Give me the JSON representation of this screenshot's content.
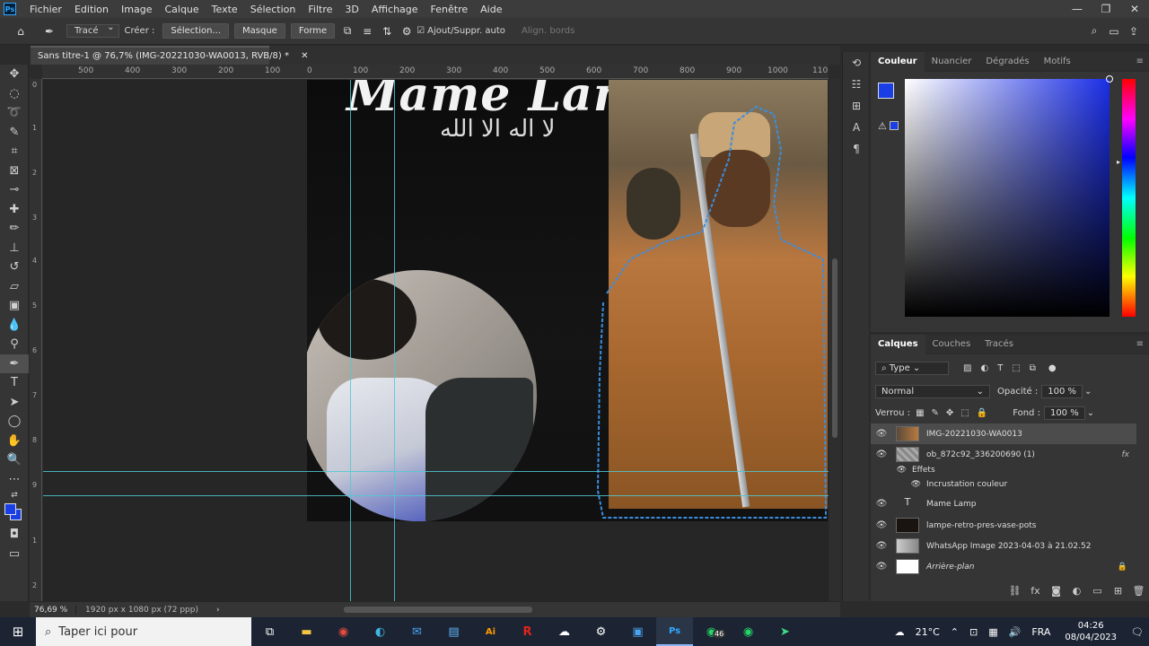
{
  "menubar": {
    "items": [
      "Fichier",
      "Edition",
      "Image",
      "Calque",
      "Texte",
      "Sélection",
      "Filtre",
      "3D",
      "Affichage",
      "Fenêtre",
      "Aide"
    ]
  },
  "options": {
    "mode": "Tracé",
    "create_label": "Créer :",
    "selection_btn": "Sélection...",
    "mask_btn": "Masque",
    "shape_btn": "Forme",
    "auto_add_label": "Ajout/Suppr. auto",
    "align_edges_label": "Align. bords"
  },
  "document": {
    "tab_title": "Sans titre-1 @ 76,7% (IMG-20221030-WA0013, RVB/8) *"
  },
  "canvas": {
    "title_text": "Mame Lam",
    "arabic_text": "لا اله الا الله"
  },
  "ruler_top": [
    "500",
    "400",
    "300",
    "200",
    "100",
    "0",
    "100",
    "200",
    "300",
    "400",
    "500",
    "600",
    "700",
    "800",
    "900",
    "1000",
    "110"
  ],
  "ruler_left": [
    "0",
    "1",
    "2",
    "3",
    "4",
    "5",
    "6",
    "7",
    "8",
    "9",
    "1",
    "2"
  ],
  "status": {
    "zoom": "76,69 %",
    "dimensions": "1920 px x 1080 px (72 ppp)"
  },
  "color_panel": {
    "tabs": [
      "Couleur",
      "Nuancier",
      "Dégradés",
      "Motifs"
    ],
    "active_tab": "Couleur",
    "foreground_color": "#1a3ee6"
  },
  "layers_panel": {
    "tabs": [
      "Calques",
      "Couches",
      "Tracés"
    ],
    "filter": "Type",
    "blend_mode": "Normal",
    "opacity_label": "Opacité :",
    "opacity_value": "100 %",
    "lock_label": "Verrou :",
    "fill_label": "Fond :",
    "fill_value": "100 %",
    "layers": [
      {
        "name": "IMG-20221030-WA0013",
        "selected": true
      },
      {
        "name": "ob_872c92_336200690 (1)",
        "fx": "fx"
      },
      {
        "name": "Effets"
      },
      {
        "name": "Incrustation couleur"
      },
      {
        "name": "Mame Lamp",
        "type": "text"
      },
      {
        "name": "lampe-retro-pres-vase-pots"
      },
      {
        "name": "WhatsApp Image 2023-04-03 à 21.02.52"
      },
      {
        "name": "Arrière-plan",
        "locked": true
      }
    ]
  },
  "taskbar": {
    "search_placeholder": "Taper ici pour",
    "weather": "21°C",
    "language": "FRA",
    "time": "04:26",
    "date": "08/04/2023",
    "whatsapp_badge": "46"
  }
}
